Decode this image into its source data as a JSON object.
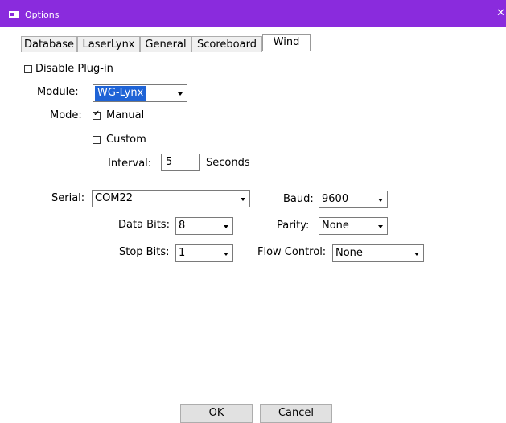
{
  "window": {
    "title": "Options",
    "close_glyph": "✕"
  },
  "tabs": [
    {
      "label": "Database"
    },
    {
      "label": "LaserLynx"
    },
    {
      "label": "General"
    },
    {
      "label": "Scoreboard"
    },
    {
      "label": "Wind",
      "active": true
    }
  ],
  "disable_plugin": {
    "label": "Disable Plug-in",
    "checked": false
  },
  "module": {
    "label": "Module:",
    "value": "WG-Lynx"
  },
  "mode": {
    "label": "Mode:",
    "manual": {
      "label": "Manual",
      "checked": true
    },
    "custom": {
      "label": "Custom",
      "checked": false
    },
    "interval_label": "Interval:",
    "interval_value": "5",
    "interval_unit": "Seconds"
  },
  "serial": {
    "label": "Serial:",
    "value": "COM22"
  },
  "baud": {
    "label": "Baud:",
    "value": "9600"
  },
  "data_bits": {
    "label": "Data Bits:",
    "value": "8"
  },
  "parity": {
    "label": "Parity:",
    "value": "None"
  },
  "stop_bits": {
    "label": "Stop Bits:",
    "value": "1"
  },
  "flow_control": {
    "label": "Flow Control:",
    "value": "None"
  },
  "buttons": {
    "ok": "OK",
    "cancel": "Cancel"
  }
}
